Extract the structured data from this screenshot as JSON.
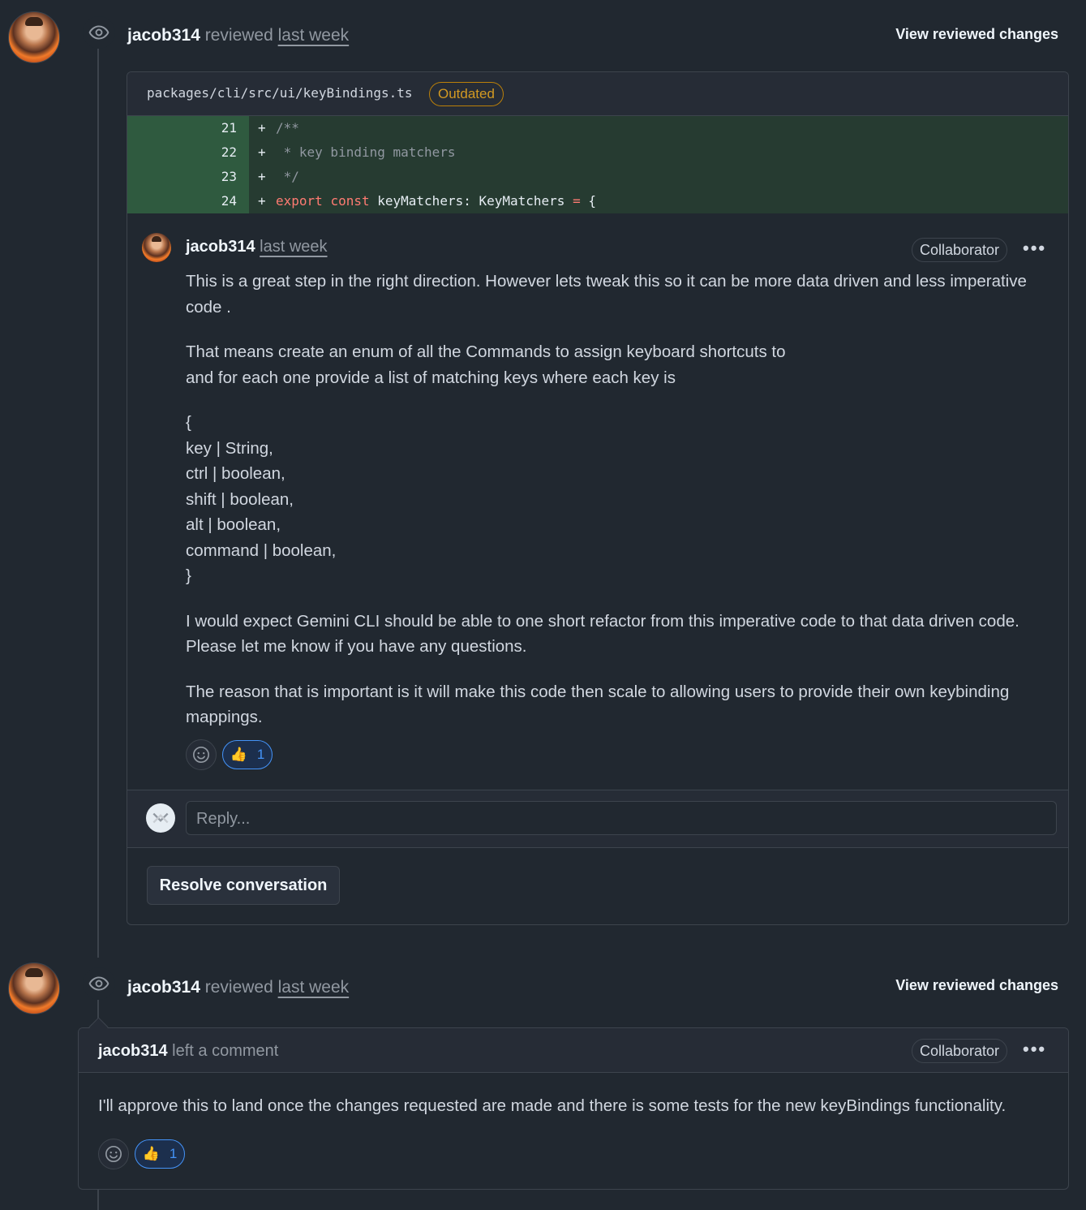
{
  "reviews": [
    {
      "author": "jacob314",
      "action": "reviewed",
      "time": "last week",
      "view_changes_label": "View reviewed changes"
    },
    {
      "author": "jacob314",
      "action": "reviewed",
      "time": "last week",
      "view_changes_label": "View reviewed changes"
    }
  ],
  "thread": {
    "file_path": "packages/cli/src/ui/keyBindings.ts",
    "outdated_label": "Outdated",
    "diff_lines": [
      {
        "number": "21",
        "sign": "+",
        "code": "/**"
      },
      {
        "number": "22",
        "sign": "+",
        "code": " * key binding matchers"
      },
      {
        "number": "23",
        "sign": "+",
        "code": " */"
      },
      {
        "number": "24",
        "sign": "+",
        "code_kw1": "export",
        "code_kw2": "const",
        "code_rest": "keyMatchers: KeyMatchers",
        "code_op": "=",
        "code_end": "{"
      }
    ],
    "comment": {
      "author": "jacob314",
      "time": "last week",
      "role_badge": "Collaborator",
      "menu_label": "•••",
      "paragraphs": [
        "This is a great step in the right direction. However lets tweak this so it can be more data driven and less imperative code .",
        "That means create an enum of all the Commands to assign keyboard shortcuts to",
        "and for each one provide a list of matching keys where each key is",
        "{",
        "key | String,",
        "ctrl | boolean,",
        "shift | boolean,",
        "alt | boolean,",
        "command | boolean,",
        "}",
        "I would expect Gemini CLI should be able to one short refactor from this imperative code to that data driven code.",
        "Please let me know if you have any questions.",
        "The reason that is important is it will make this code then scale to allowing users to provide their own keybinding mappings."
      ],
      "reaction_emoji": "👍",
      "reaction_count": "1"
    },
    "reply_placeholder": "Reply...",
    "resolve_label": "Resolve conversation"
  },
  "review_comment": {
    "author": "jacob314",
    "action": "left a comment",
    "role_badge": "Collaborator",
    "menu_label": "•••",
    "body": "I'll approve this to land once the changes requested are made and there is some tests for the new keyBindings functionality.",
    "reaction_emoji": "👍",
    "reaction_count": "1"
  },
  "colors": {
    "background": "#212830",
    "diff_added_bg": "#263b31",
    "diff_added_gutter": "#2f5a3f",
    "outdated": "#d29922",
    "reaction_accent": "#4493f8"
  }
}
